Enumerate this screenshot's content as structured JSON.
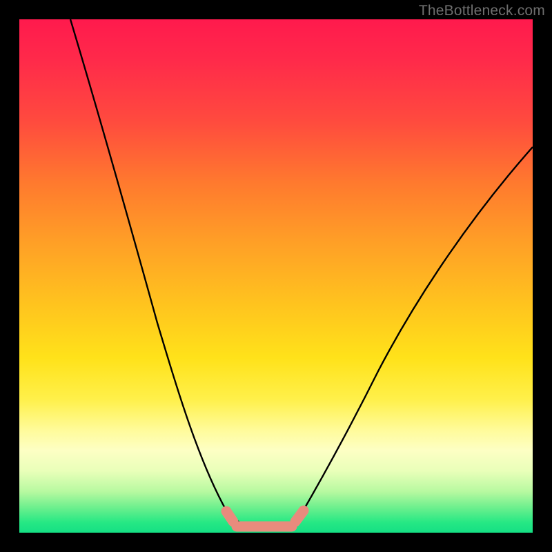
{
  "watermark": {
    "text": "TheBottleneck.com"
  },
  "chart_data": {
    "type": "line",
    "title": "",
    "xlabel": "",
    "ylabel": "",
    "xlim": [
      0,
      100
    ],
    "ylim": [
      0,
      100
    ],
    "grid": false,
    "series": [
      {
        "name": "curve",
        "x": [
          10,
          14,
          18,
          22,
          26,
          30,
          34,
          38,
          40,
          42,
          44,
          46,
          48,
          50,
          52,
          54,
          56,
          60,
          66,
          72,
          78,
          84,
          90,
          96,
          100
        ],
        "y": [
          100,
          88,
          75,
          62,
          50,
          38,
          27,
          16,
          12,
          8,
          4,
          2,
          1,
          0.5,
          0.8,
          2,
          4,
          10,
          20,
          30,
          40,
          49,
          57,
          65,
          70
        ]
      }
    ],
    "flat_segment": {
      "x_start": 41,
      "x_end": 55,
      "y": 2,
      "color": "#e98b7d"
    },
    "background": "rainbow_vertical_gradient"
  }
}
